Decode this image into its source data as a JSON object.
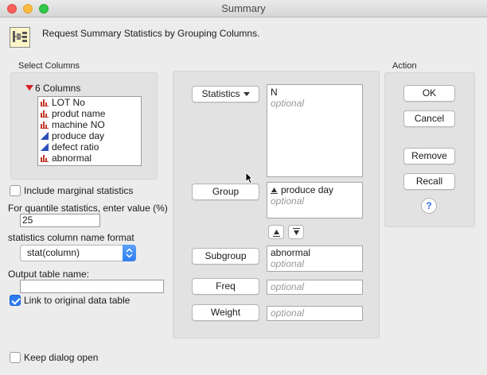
{
  "window": {
    "title": "Summary"
  },
  "header": {
    "text": "Request Summary Statistics by Grouping Columns."
  },
  "select_columns": {
    "label": "Select Columns",
    "count_label": "6 Columns",
    "items": [
      {
        "label": "LOT No",
        "icon": "nominal-bar-icon",
        "color": "#c0392b"
      },
      {
        "label": "produt name",
        "icon": "nominal-bar-icon",
        "color": "#c0392b"
      },
      {
        "label": "machine NO",
        "icon": "nominal-bar-icon",
        "color": "#c0392b"
      },
      {
        "label": "produce day",
        "icon": "continuous-triangle-icon",
        "color": "#2c4fb8"
      },
      {
        "label": "defect ratio",
        "icon": "continuous-triangle-icon",
        "color": "#2c4fb8"
      },
      {
        "label": "abnormal",
        "icon": "nominal-bar-icon",
        "color": "#c0392b"
      }
    ]
  },
  "options": {
    "include_marginal": {
      "label": "Include marginal statistics",
      "checked": false
    },
    "quantile_label": "For quantile statistics, enter value (%)",
    "quantile_value": "25",
    "name_format_label": "statistics column name format",
    "name_format_value": "stat(column)",
    "output_table_label": "Output table name:",
    "output_table_value": "",
    "link_original": {
      "label": "Link to original data table",
      "checked": true
    },
    "keep_open": {
      "label": "Keep dialog open",
      "checked": false
    }
  },
  "roles": {
    "statistics": {
      "button": "Statistics",
      "value": "N",
      "placeholder": "optional"
    },
    "group": {
      "button": "Group",
      "value": "produce day",
      "placeholder": "optional"
    },
    "subgroup": {
      "button": "Subgroup",
      "value": "abnormal",
      "placeholder": "optional"
    },
    "freq": {
      "button": "Freq",
      "placeholder": "optional"
    },
    "weight": {
      "button": "Weight",
      "placeholder": "optional"
    }
  },
  "action": {
    "label": "Action",
    "ok": "OK",
    "cancel": "Cancel",
    "remove": "Remove",
    "recall": "Recall",
    "help": "?"
  },
  "colors": {
    "accent": "#2b7bf3",
    "close": "#fc605c",
    "minimize": "#fdbc40",
    "maximize": "#34c84a"
  }
}
